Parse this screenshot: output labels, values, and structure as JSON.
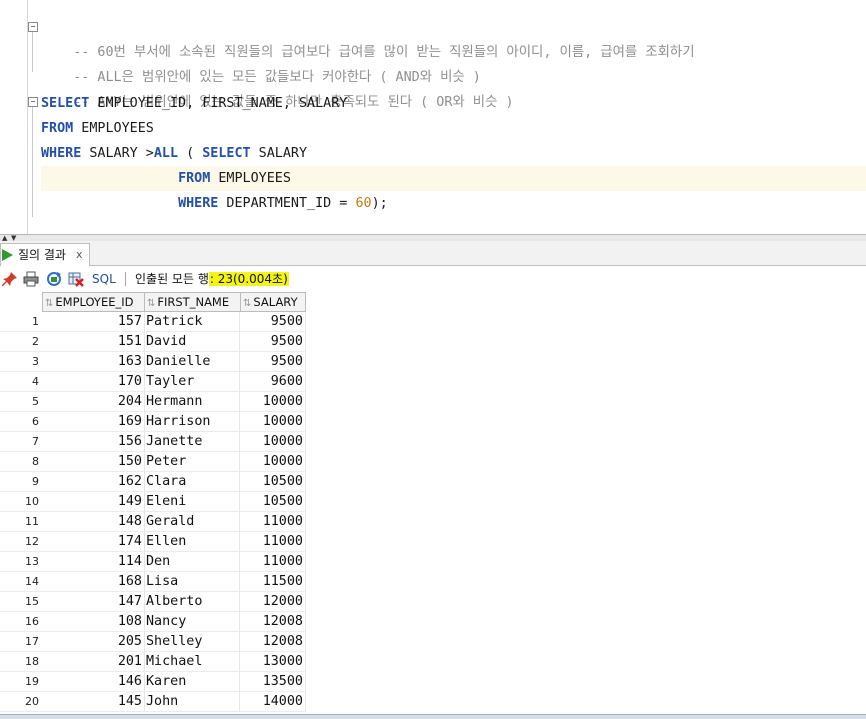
{
  "editor": {
    "comments": [
      "-- 60번 부서에 소속된 직원들의 급여보다 급여를 많이 받는 직원들의 아이디, 이름, 급여를 조회하기",
      "-- ALL은 범위안에 있는 모든 값들보다 커야한다 ( AND와 비슷 )",
      "-- ANY는 범위안에 있는 값들 중 하나만 충족되도 된다 ( OR와 비슷 )"
    ],
    "sql": {
      "l1_kw": "SELECT",
      "l1_rest": " EMPLOYEE_ID, FIRST_NAME, SALARY",
      "l2_kw": "FROM",
      "l2_rest": " EMPLOYEES",
      "l3_kw1": "WHERE",
      "l3_mid": " SALARY >",
      "l3_kw2": "ALL",
      "l3_paren": " ( ",
      "l3_kw3": "SELECT",
      "l3_rest": " SALARY",
      "l4_indent": "                 ",
      "l4_kw": "FROM",
      "l4_rest": " EMPLOYEES",
      "l5_indent": "                 ",
      "l5_kw": "WHERE",
      "l5_mid": " DEPARTMENT_ID = ",
      "l5_num": "60",
      "l5_end": ");"
    }
  },
  "results_tab": {
    "label": "질의 결과",
    "close": "x"
  },
  "toolbar": {
    "sql_label": "SQL",
    "status_prefix": "인출된 모든 행",
    "status_count": ": 23(0.004초)"
  },
  "grid": {
    "columns": [
      "EMPLOYEE_ID",
      "FIRST_NAME",
      "SALARY"
    ],
    "rows": [
      [
        "1",
        "157",
        "Patrick",
        "9500"
      ],
      [
        "2",
        "151",
        "David",
        "9500"
      ],
      [
        "3",
        "163",
        "Danielle",
        "9500"
      ],
      [
        "4",
        "170",
        "Tayler",
        "9600"
      ],
      [
        "5",
        "204",
        "Hermann",
        "10000"
      ],
      [
        "6",
        "169",
        "Harrison",
        "10000"
      ],
      [
        "7",
        "156",
        "Janette",
        "10000"
      ],
      [
        "8",
        "150",
        "Peter",
        "10000"
      ],
      [
        "9",
        "162",
        "Clara",
        "10500"
      ],
      [
        "10",
        "149",
        "Eleni",
        "10500"
      ],
      [
        "11",
        "148",
        "Gerald",
        "11000"
      ],
      [
        "12",
        "174",
        "Ellen",
        "11000"
      ],
      [
        "13",
        "114",
        "Den",
        "11000"
      ],
      [
        "14",
        "168",
        "Lisa",
        "11500"
      ],
      [
        "15",
        "147",
        "Alberto",
        "12000"
      ],
      [
        "16",
        "108",
        "Nancy",
        "12008"
      ],
      [
        "17",
        "205",
        "Shelley",
        "12008"
      ],
      [
        "18",
        "201",
        "Michael",
        "13000"
      ],
      [
        "19",
        "146",
        "Karen",
        "13500"
      ],
      [
        "20",
        "145",
        "John",
        "14000"
      ]
    ]
  },
  "colors": {
    "keyword": "#2450a5",
    "comment": "#8f8f8f",
    "number": "#c47a14",
    "highlight": "#f4f416",
    "current_line": "#fdf9e8"
  }
}
